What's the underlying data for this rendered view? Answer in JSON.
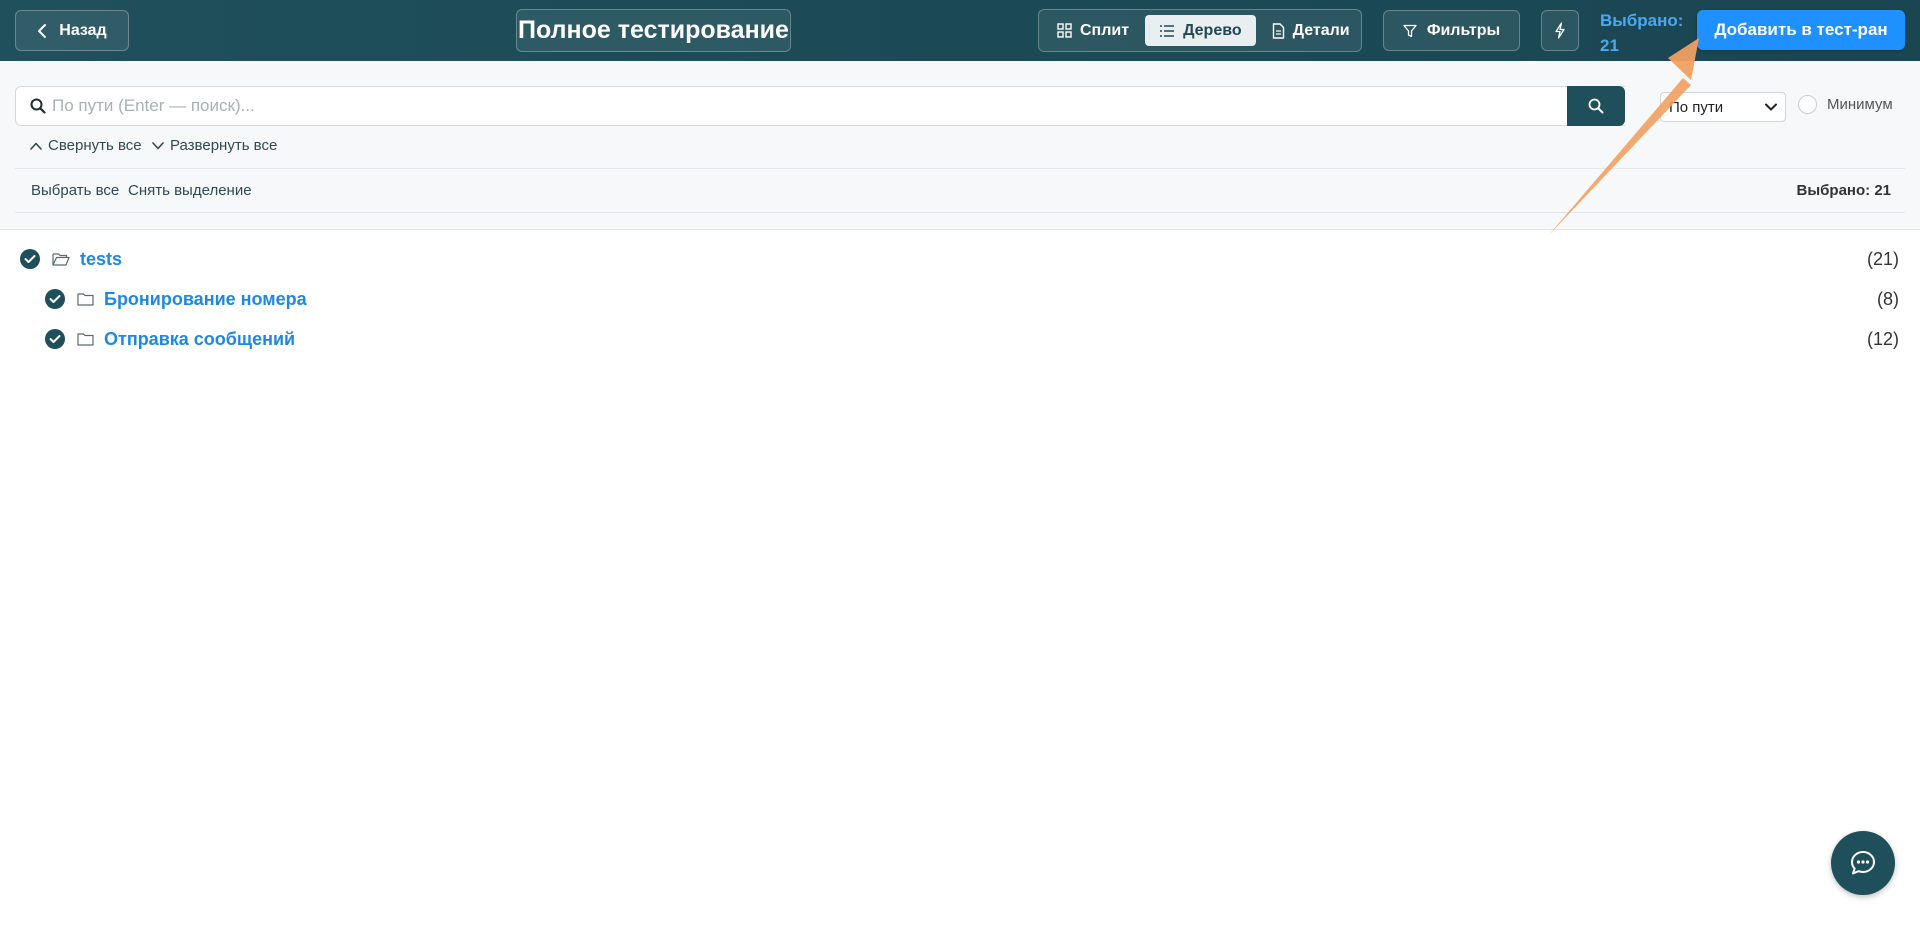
{
  "header": {
    "back_label": "Назад",
    "title": "Полное тестирование",
    "view_tabs": [
      {
        "label": "Сплит",
        "icon": "split-grid-icon",
        "active": false
      },
      {
        "label": "Дерево",
        "icon": "tree-list-icon",
        "active": true
      },
      {
        "label": "Детали",
        "icon": "document-icon",
        "active": false
      }
    ],
    "filters_label": "Фильтры",
    "selected_label": "Выбрано:",
    "selected_count": "21",
    "add_button_label": "Добавить в тест-ран"
  },
  "toolbar": {
    "search_placeholder": "По пути (Enter — поиск)...",
    "search_value": "",
    "sort_value": "По пути",
    "minimum_label": "Минимум",
    "collapse_all": "Свернуть все",
    "expand_all": "Развернуть все",
    "select_all": "Выбрать все",
    "deselect": "Снять выделение",
    "selected_summary": "Выбрано: 21"
  },
  "tree": [
    {
      "name": "tests",
      "count": "(21)",
      "checked": true,
      "level": 0,
      "open": true
    },
    {
      "name": "Бронирование номера",
      "count": "(8)",
      "checked": true,
      "level": 1,
      "open": false
    },
    {
      "name": "Отправка сообщений",
      "count": "(12)",
      "checked": true,
      "level": 1,
      "open": false
    }
  ],
  "colors": {
    "header_bg": "#1b4a55",
    "accent_blue": "#1e90ff",
    "link_blue": "#1e88e5",
    "check_fill": "#1f4f5b",
    "annotation_arrow": "#f0a060"
  }
}
